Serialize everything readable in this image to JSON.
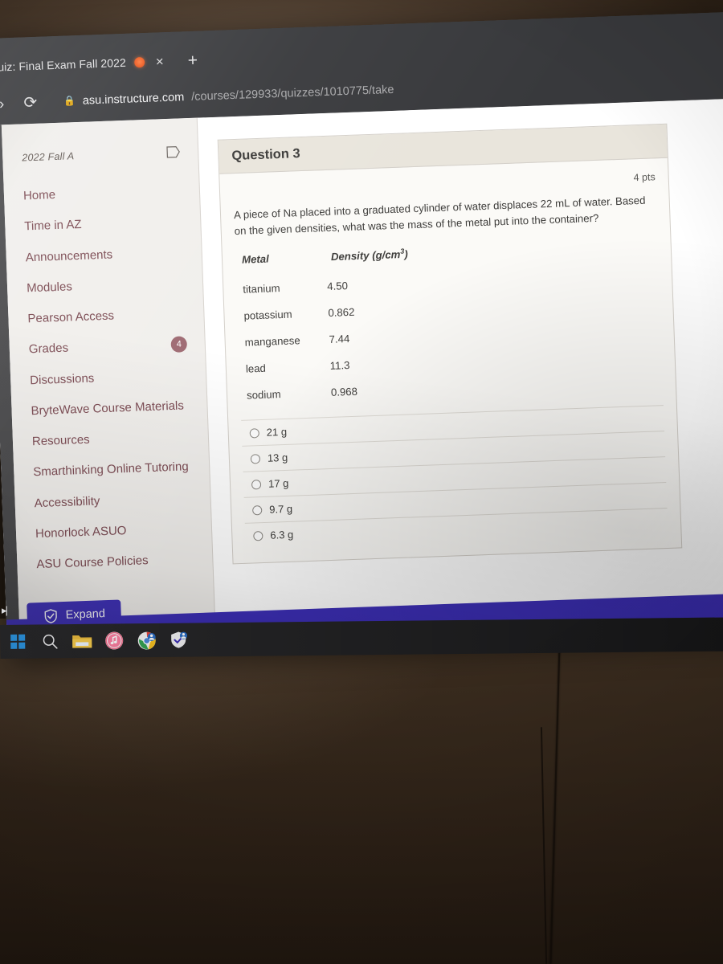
{
  "browser": {
    "tab_title": "uiz: Final Exam Fall 2022",
    "recording_indicator": "recording-dot",
    "close_label": "×",
    "new_tab_label": "+",
    "forward_label": "»",
    "reload_label": "⟳",
    "lock_label": "ὑ2",
    "url_host": "asu.instructure.com",
    "url_path": "/courses/129933/quizzes/1010775/take"
  },
  "sidebar": {
    "course_term": "2022 Fall A",
    "items": [
      {
        "label": "Home",
        "badge": ""
      },
      {
        "label": "Time in AZ",
        "badge": ""
      },
      {
        "label": "Announcements",
        "badge": ""
      },
      {
        "label": "Modules",
        "badge": ""
      },
      {
        "label": "Pearson Access",
        "badge": ""
      },
      {
        "label": "Grades",
        "badge": "4"
      },
      {
        "label": "Discussions",
        "badge": ""
      },
      {
        "label": "BryteWave Course Materials",
        "badge": ""
      },
      {
        "label": "Resources",
        "badge": ""
      },
      {
        "label": "Smarthinking Online Tutoring",
        "badge": ""
      },
      {
        "label": "Accessibility",
        "badge": ""
      },
      {
        "label": "Honorlock ASUO",
        "badge": ""
      },
      {
        "label": "ASU Course Policies",
        "badge": ""
      }
    ]
  },
  "quiz": {
    "question_title": "Question 3",
    "points": "4 pts",
    "question_text": "A piece of Na placed into a graduated cylinder of water displaces 22 mL of water.  Based on the given densities, what was the mass of the metal put into the container?",
    "table": {
      "headers": [
        "Metal",
        "Density (g/cm³)"
      ],
      "header_metal": "Metal",
      "header_density_main": "Density (g/cm",
      "header_density_sup": "3",
      "header_density_end": ")",
      "rows": [
        {
          "metal": "titanium",
          "density": "4.50"
        },
        {
          "metal": "potassium",
          "density": "0.862"
        },
        {
          "metal": "manganese",
          "density": "7.44"
        },
        {
          "metal": "lead",
          "density": "11.3"
        },
        {
          "metal": "sodium",
          "density": "0.968"
        }
      ]
    },
    "answers": [
      {
        "label": "21 g",
        "selected": false
      },
      {
        "label": "13 g",
        "selected": false
      },
      {
        "label": "17 g",
        "selected": false
      },
      {
        "label": "9.7 g",
        "selected": false
      },
      {
        "label": "6.3 g",
        "selected": false
      }
    ]
  },
  "honorlock": {
    "expand_label": "Expand",
    "collapse_label": "▸|"
  },
  "taskbar": {
    "icons": [
      "windows-start-icon",
      "search-icon",
      "file-explorer-icon",
      "itunes-icon",
      "chrome-icon",
      "honorlock-shield-icon"
    ]
  },
  "colors": {
    "honorlock_purple": "#3d2fb8",
    "canvas_sidebar_link": "#7b4a52",
    "badge": "#9e6a72",
    "recording_dot": "#ef5b20",
    "chrome_toolbar": "#38393c"
  }
}
